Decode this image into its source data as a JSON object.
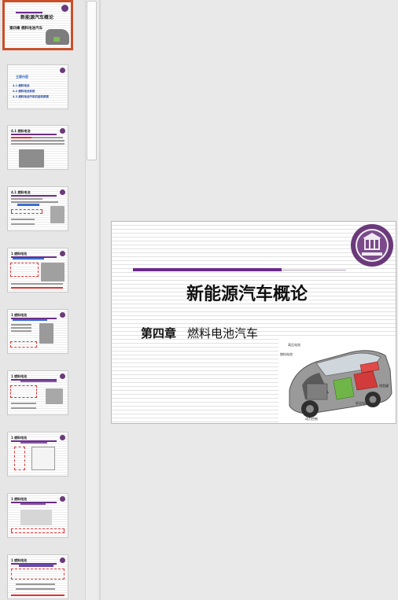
{
  "thumbnails": [
    {
      "title": "新能源汽车概论",
      "subtitle": "第四章 燃料电池汽车",
      "selected": true
    },
    {
      "title": "主要内容",
      "items": [
        "4.1 燃料电池",
        "4.2 燃料电池系统",
        "4.3 燃料电池汽车的结构原理"
      ]
    },
    {
      "title": "4.1 燃料电池"
    },
    {
      "title": "4.1 燃料电池"
    },
    {
      "title": "1 燃料电池"
    },
    {
      "title": "1 燃料电池"
    },
    {
      "title": "1 燃料电池"
    },
    {
      "title": "1 燃料电池"
    },
    {
      "title": "1 燃料电池"
    },
    {
      "title": "1 燃料电池"
    }
  ],
  "slide": {
    "title": "新能源汽车概论",
    "chapter_number": "第四章",
    "chapter_title": "燃料电池汽车",
    "car_labels": [
      "高压电池",
      "燃料电池",
      "储氢罐",
      "驱动电机",
      "动力控制"
    ]
  },
  "colors": {
    "accent_purple": "#6b2a8c",
    "selection_orange": "#c8502a"
  }
}
